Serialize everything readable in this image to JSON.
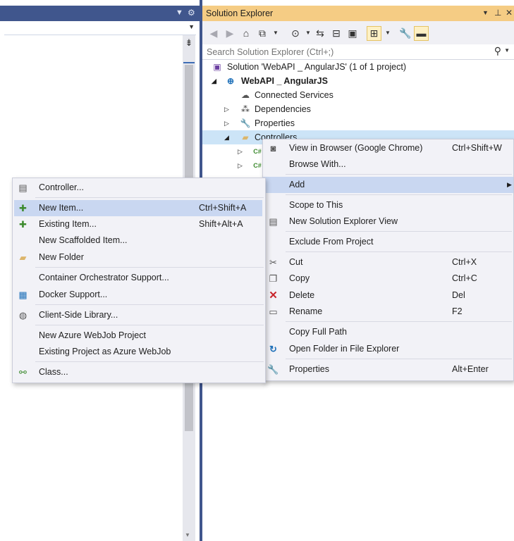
{
  "colors": {
    "accent": "#40568d",
    "panel_title": "#f5cc84",
    "menu_bg": "#f2f2f7",
    "highlight": "#c9d7f1",
    "selection": "#cce4f7"
  },
  "solution_explorer": {
    "title": "Solution Explorer",
    "search_placeholder": "Search Solution Explorer (Ctrl+;)",
    "tree": [
      {
        "label": "Solution 'WebAPI _ AngularJS' (1 of 1 project)",
        "icon": "solution-icon"
      },
      {
        "label": "WebAPI _ AngularJS",
        "icon": "web-project-icon",
        "expanded": true
      },
      {
        "label": "Connected Services",
        "icon": "cloud-icon"
      },
      {
        "label": "Dependencies",
        "icon": "dependencies-icon",
        "expanded": false
      },
      {
        "label": "Properties",
        "icon": "wrench-icon",
        "expanded": false
      },
      {
        "label": "Controllers",
        "icon": "folder-icon",
        "expanded": true
      }
    ]
  },
  "context_menu": {
    "items": [
      {
        "label": "View in Browser (Google Chrome)",
        "shortcut": "Ctrl+Shift+W",
        "icon": "browser-icon"
      },
      {
        "label": "Browse With...",
        "shortcut": ""
      },
      {
        "label": "Add",
        "shortcut": "",
        "submenu": true
      },
      {
        "label": "Scope to This",
        "shortcut": ""
      },
      {
        "label": "New Solution Explorer View",
        "shortcut": "",
        "icon": "new-view-icon"
      },
      {
        "label": "Exclude From Project",
        "shortcut": ""
      },
      {
        "label": "Cut",
        "shortcut": "Ctrl+X",
        "icon": "scissors-icon"
      },
      {
        "label": "Copy",
        "shortcut": "Ctrl+C",
        "icon": "copy-icon"
      },
      {
        "label": "Delete",
        "shortcut": "Del",
        "icon": "delete-x-icon"
      },
      {
        "label": "Rename",
        "shortcut": "F2",
        "icon": "rename-icon"
      },
      {
        "label": "Copy Full Path",
        "shortcut": ""
      },
      {
        "label": "Open Folder in File Explorer",
        "shortcut": "",
        "icon": "open-folder-arrow-icon"
      },
      {
        "label": "Properties",
        "shortcut": "Alt+Enter",
        "icon": "wrench-icon"
      }
    ]
  },
  "add_submenu": {
    "items": [
      {
        "label": "Controller...",
        "shortcut": "",
        "icon": "controller-icon"
      },
      {
        "label": "New Item...",
        "shortcut": "Ctrl+Shift+A",
        "icon": "new-item-icon"
      },
      {
        "label": "Existing Item...",
        "shortcut": "Shift+Alt+A",
        "icon": "existing-item-icon"
      },
      {
        "label": "New Scaffolded Item...",
        "shortcut": ""
      },
      {
        "label": "New Folder",
        "shortcut": "",
        "icon": "new-folder-icon"
      },
      {
        "label": "Container Orchestrator Support...",
        "shortcut": ""
      },
      {
        "label": "Docker Support...",
        "shortcut": "",
        "icon": "docker-icon"
      },
      {
        "label": "Client-Side Library...",
        "shortcut": "",
        "icon": "globe-icon"
      },
      {
        "label": "New Azure WebJob Project",
        "shortcut": ""
      },
      {
        "label": "Existing Project as Azure WebJob",
        "shortcut": ""
      },
      {
        "label": "Class...",
        "shortcut": "",
        "icon": "class-icon"
      }
    ]
  }
}
